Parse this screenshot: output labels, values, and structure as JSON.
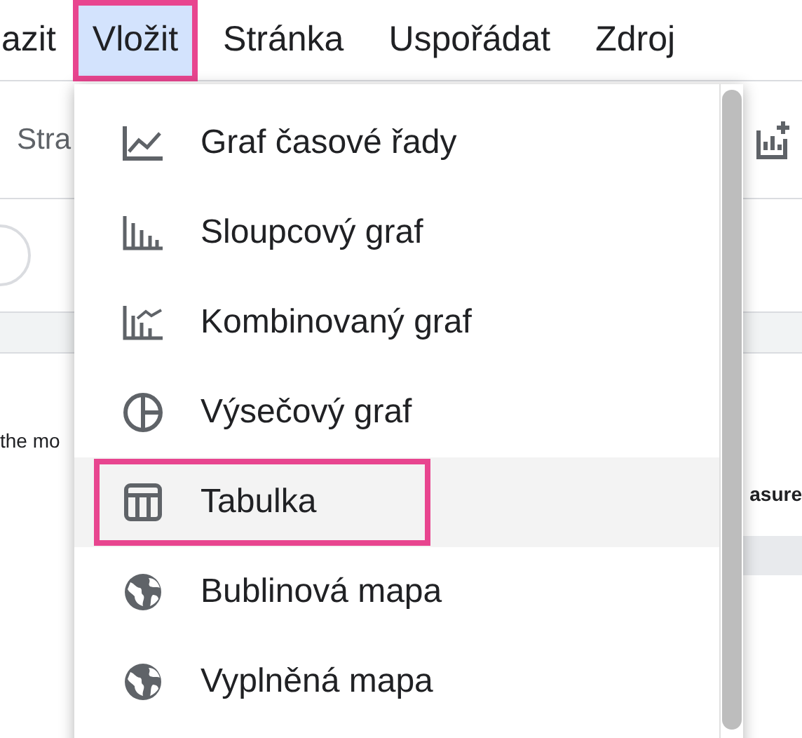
{
  "menu_bar": [
    {
      "label": "azit",
      "selected": false,
      "annotated": false
    },
    {
      "label": "Vložit",
      "selected": true,
      "annotated": true
    },
    {
      "label": "Stránka",
      "selected": false,
      "annotated": false
    },
    {
      "label": "Uspořádat",
      "selected": false,
      "annotated": false
    },
    {
      "label": "Zdroj",
      "selected": false,
      "annotated": false
    }
  ],
  "background": {
    "toolbar_text": "Stra",
    "text_left": "the mo",
    "text_right": "asure"
  },
  "insert_menu": [
    {
      "label": "Graf časové řady",
      "kind": "line",
      "selected": false,
      "annotated": false
    },
    {
      "label": "Sloupcový graf",
      "kind": "bar",
      "selected": false,
      "annotated": false
    },
    {
      "label": "Kombinovaný graf",
      "kind": "combo",
      "selected": false,
      "annotated": false
    },
    {
      "label": "Výsečový graf",
      "kind": "pie",
      "selected": false,
      "annotated": false
    },
    {
      "label": "Tabulka",
      "kind": "table",
      "selected": true,
      "annotated": true
    },
    {
      "label": "Bublinová mapa",
      "kind": "map",
      "selected": false,
      "annotated": false
    },
    {
      "label": "Vyplněná mapa",
      "kind": "map",
      "selected": false,
      "annotated": false
    }
  ]
}
